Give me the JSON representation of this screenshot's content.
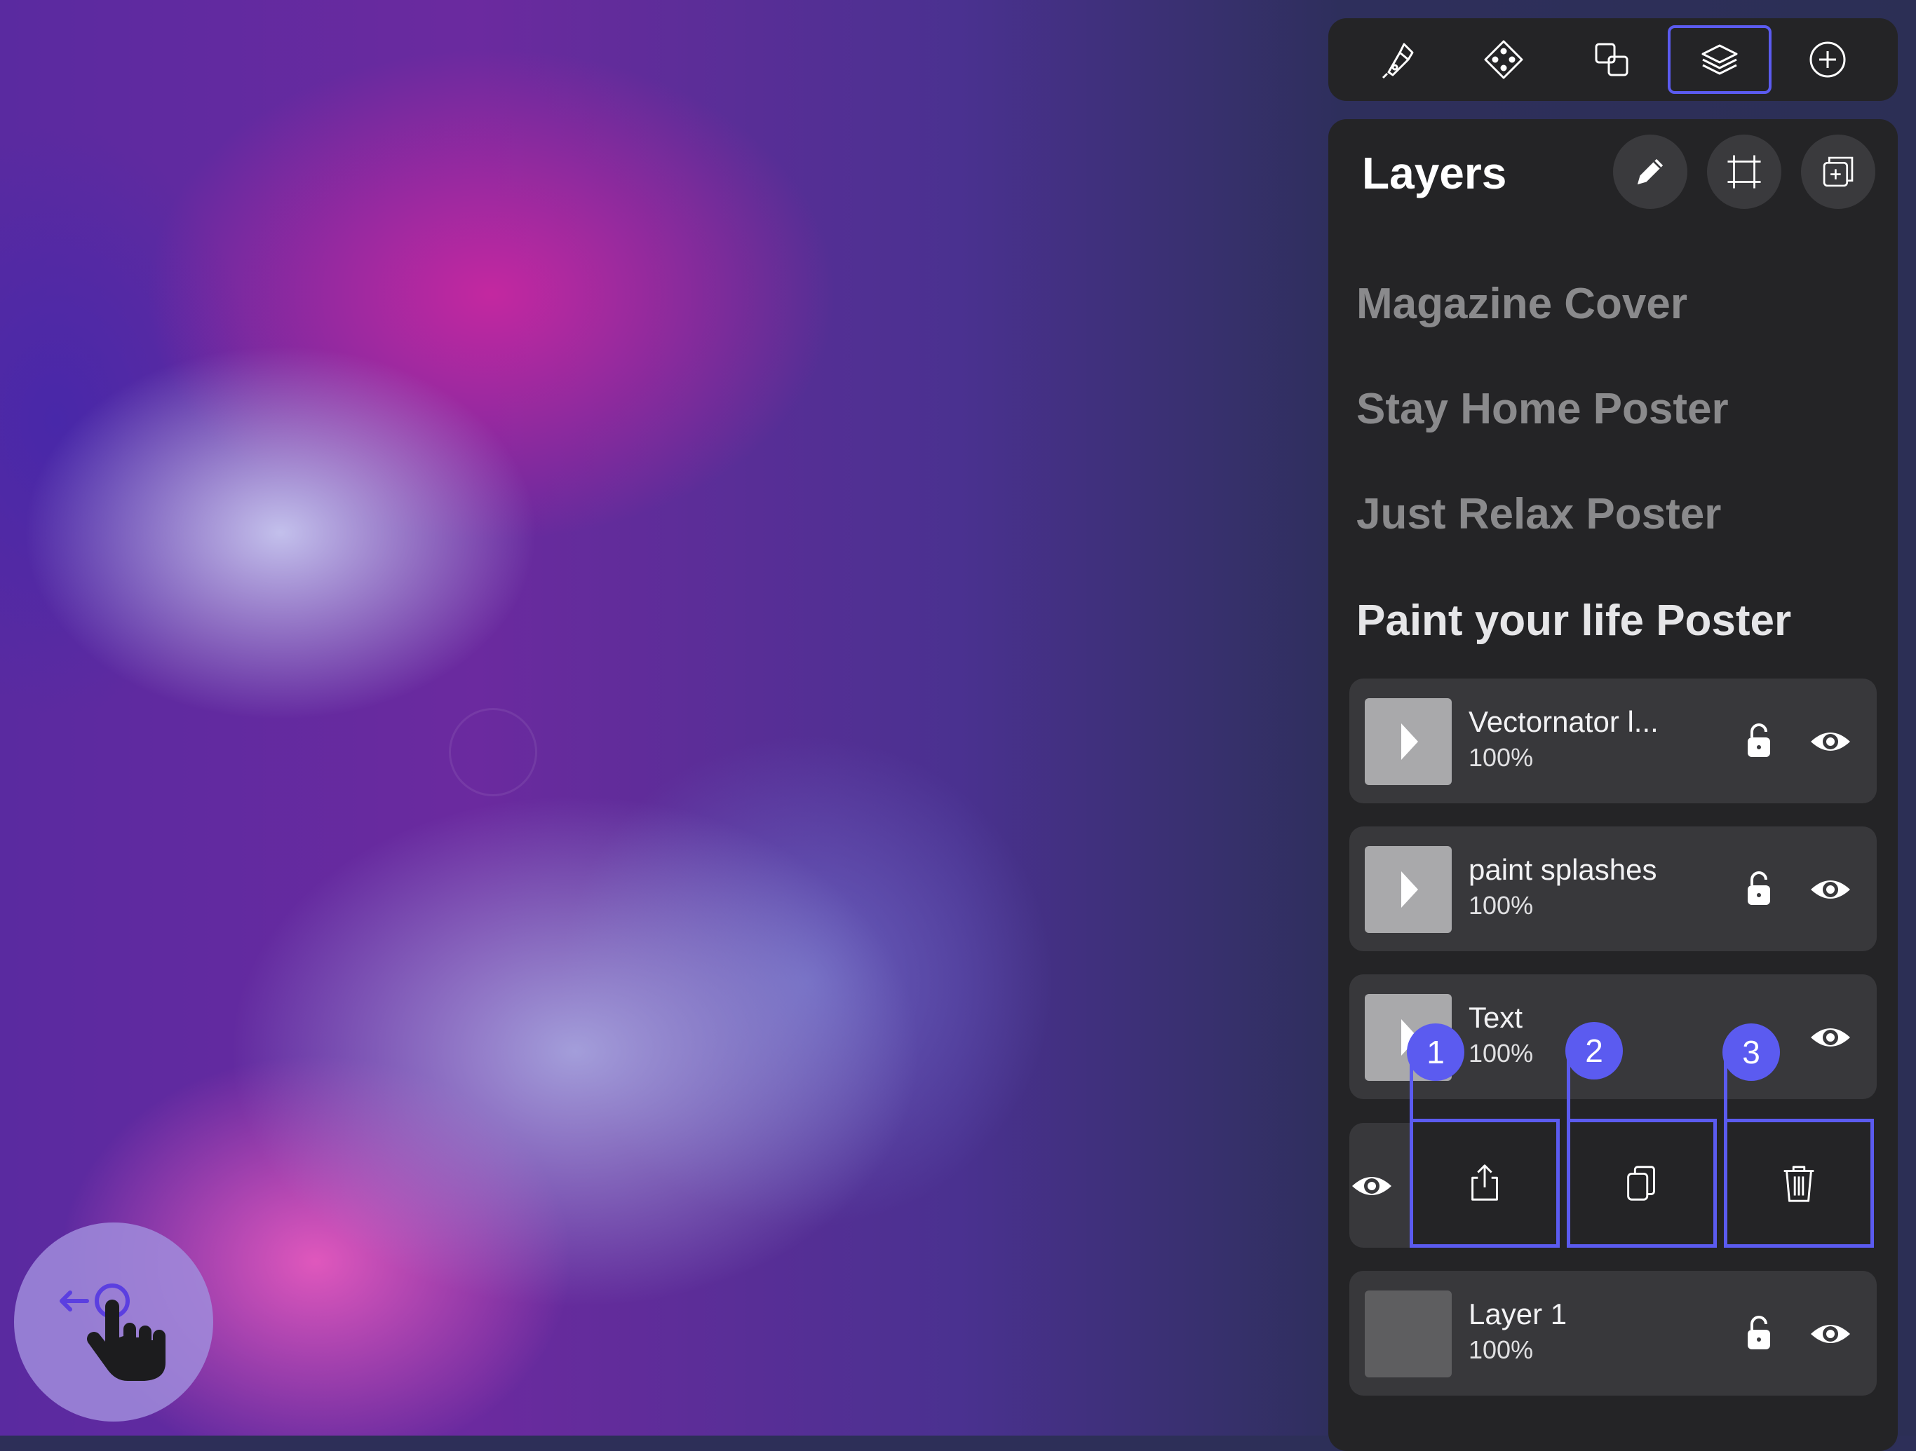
{
  "toolbar": {
    "tools": [
      {
        "name": "pen-tool",
        "icon": "pen-nib-icon",
        "active": false
      },
      {
        "name": "node-tool",
        "icon": "node-diamond-icon",
        "active": false
      },
      {
        "name": "shapes-tool",
        "icon": "shapes-icon",
        "active": false
      },
      {
        "name": "layers-tool",
        "icon": "layers-icon",
        "active": true
      },
      {
        "name": "add-tool",
        "icon": "plus-circle-icon",
        "active": false
      }
    ]
  },
  "panel": {
    "title": "Layers",
    "header_buttons": [
      "pencil-icon",
      "artboard-icon",
      "duplicate-add-icon"
    ]
  },
  "documents": [
    {
      "name": "Magazine Cover",
      "active": false
    },
    {
      "name": "Stay Home Poster",
      "active": false
    },
    {
      "name": "Just Relax Poster",
      "active": false
    },
    {
      "name": "Paint your life Poster",
      "active": true
    }
  ],
  "layers": [
    {
      "name": "Vectornator l...",
      "opacity": "100%",
      "has_children": true
    },
    {
      "name": "paint splashes",
      "opacity": "100%",
      "has_children": true
    },
    {
      "name": "Text",
      "opacity": "100%",
      "has_children": true
    },
    {
      "name": "Layer 1",
      "opacity": "100%",
      "has_children": false
    }
  ],
  "swipe_actions": [
    {
      "badge": "1",
      "icon": "share-icon"
    },
    {
      "badge": "2",
      "icon": "duplicate-icon"
    },
    {
      "badge": "3",
      "icon": "trash-icon"
    }
  ],
  "colors": {
    "accent": "#5b5bf0",
    "panel_bg": "#242426",
    "row_bg": "#38383b"
  },
  "gesture_hint": {
    "icon": "swipe-left-hand-icon"
  }
}
